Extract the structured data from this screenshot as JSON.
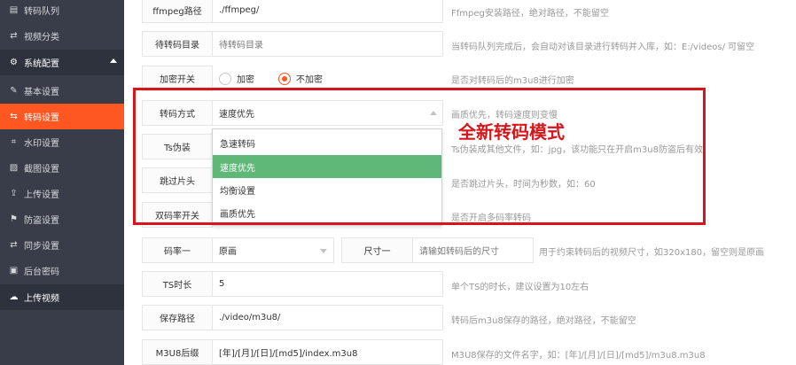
{
  "sidebar": {
    "items": [
      {
        "label": "转码队列",
        "icon": "list-icon"
      },
      {
        "label": "视频分类",
        "icon": "exchange-icon"
      },
      {
        "label": "系统配置",
        "icon": "gear-icon"
      },
      {
        "label": "基本设置",
        "icon": "edit-icon"
      },
      {
        "label": "转码设置",
        "icon": "transcode-icon"
      },
      {
        "label": "水印设置",
        "icon": "crop-icon"
      },
      {
        "label": "截图设置",
        "icon": "image-icon"
      },
      {
        "label": "上传设置",
        "icon": "upload-icon"
      },
      {
        "label": "防盗设置",
        "icon": "flag-icon"
      },
      {
        "label": "同步设置",
        "icon": "sync-icon"
      },
      {
        "label": "后台密码",
        "icon": "password-icon"
      },
      {
        "label": "上传视频",
        "icon": "cloud-upload-icon"
      }
    ]
  },
  "form": {
    "ffmpeg": {
      "label": "ffmpeg路径",
      "value": "./ffmpeg/",
      "hint": "Ffmpeg安装路径，绝对路径，不能留空"
    },
    "pending_dir": {
      "label": "待转码目录",
      "placeholder": "待转码目录",
      "hint": "当转码队列完成后，会自动对该目录进行转码并入库，如：E:/videos/ 可留空"
    },
    "encrypt": {
      "label": "加密开关",
      "option_on": "加密",
      "option_off": "不加密",
      "selected": "不加密",
      "hint": "是否对转码后的m3u8进行加密"
    },
    "mode": {
      "label": "转码方式",
      "value": "速度优先",
      "hint": "画质优先，转码速度则变慢",
      "options": [
        "急速转码",
        "速度优先",
        "均衡设置",
        "画质优先"
      ]
    },
    "ts_fake": {
      "label": "Ts伪装",
      "hint": "Ts伪装成其他文件，如：jpg，该功能只在开启m3u8防盗后有效"
    },
    "skip": {
      "label": "跳过片头",
      "hint": "是否跳过片头，时间为秒数，如：60"
    },
    "multirate": {
      "label": "双码率开关",
      "hint": "是否开启多码率转码"
    },
    "bitrate1": {
      "label": "码率一",
      "value": "原画",
      "size_label": "尺寸一",
      "size_placeholder": "请输如转码后的尺寸",
      "hint": "用于约束转码后的视频尺寸，如320x180，留空则是原画"
    },
    "ts_duration": {
      "label": "TS时长",
      "value": "5",
      "hint": "单个TS的时长，建议设置为10左右"
    },
    "save_path": {
      "label": "保存路径",
      "value": "./video/m3u8/",
      "hint": "转码后m3u8保存的路径，绝对路径，不能留空"
    },
    "m3u8_suffix": {
      "label": "M3U8后缀",
      "value": "[年]/[月]/[日]/[md5]/index.m3u8",
      "hint": "M3U8保存的文件名字，如：[年]/[月]/[日]/[md5]/m3u8.m3u8"
    }
  },
  "annotation": {
    "callout": "全新转码模式",
    "color": "#d7161b"
  },
  "colors": {
    "sidebar_bg": "#393d49",
    "active": "#ff5722",
    "selected_option": "#5fb878"
  }
}
